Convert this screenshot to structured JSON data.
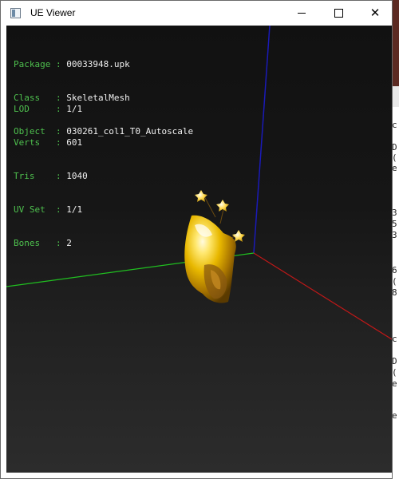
{
  "window": {
    "title": "UE Viewer",
    "icon": "app-window-icon",
    "buttons": {
      "minimize": "minimize-icon",
      "maximize": "maximize-icon",
      "close": "✕"
    }
  },
  "info_block_1": [
    {
      "key": "Package",
      "sep": " : ",
      "value": "00033948.upk"
    },
    {
      "key": "Class  ",
      "sep": " : ",
      "value": "SkeletalMesh"
    },
    {
      "key": "Object ",
      "sep": " : ",
      "value": "030261_col1_T0_Autoscale"
    }
  ],
  "info_block_2": [
    {
      "key": "LOD    ",
      "sep": " : ",
      "value": "1/1"
    },
    {
      "key": "Verts  ",
      "sep": " : ",
      "value": "601"
    },
    {
      "key": "Tris   ",
      "sep": " : ",
      "value": "1040"
    },
    {
      "key": "UV Set ",
      "sep": " : ",
      "value": "1/1"
    },
    {
      "key": "Bones  ",
      "sep": " : ",
      "value": "2"
    }
  ],
  "axes": {
    "x_color": "#c01818",
    "y_color": "#20c020",
    "z_color": "#1a1ab8"
  },
  "mesh_color": "#e8b800",
  "background_window_chars": [
    "c",
    "D",
    "(",
    "e",
    "3",
    "5",
    "3",
    "6",
    "(",
    "8",
    "c",
    "D",
    "(",
    "e",
    "e"
  ]
}
